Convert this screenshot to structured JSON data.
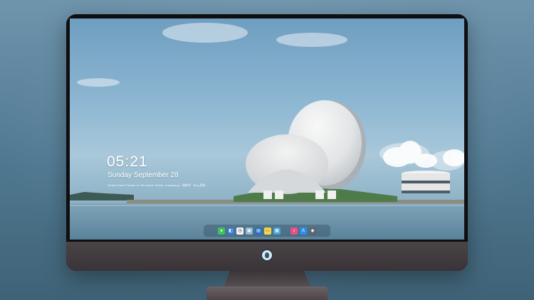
{
  "lockscreen": {
    "time": "05:21",
    "date": "Sunday September 28",
    "caption": "Zhuhai Grand Theatre on Yeli Island, Zhuhai, Guangdong · 摄影师 · Bing 壁纸"
  },
  "dock": {
    "items": [
      {
        "name": "messages-icon",
        "color": "#3fc35b",
        "glyph": "●"
      },
      {
        "name": "finder-icon",
        "color": "#3a7bd5",
        "glyph": "◧"
      },
      {
        "name": "clock-icon",
        "color": "#f2f2f2",
        "glyph": "◷"
      },
      {
        "name": "preview-icon",
        "color": "#8fb8d0",
        "glyph": "▣"
      },
      {
        "name": "clapper-icon",
        "color": "#2d6fc4",
        "glyph": "▤"
      },
      {
        "name": "notes-icon",
        "color": "#f5d547",
        "glyph": "▭"
      },
      {
        "name": "photos-icon",
        "color": "#4aa3df",
        "glyph": "▩"
      },
      {
        "name": "music-icon",
        "color": "#ee4f84",
        "glyph": "♪"
      },
      {
        "name": "appstore-icon",
        "color": "#2b8ef0",
        "glyph": "A"
      },
      {
        "name": "camera-icon",
        "color": "#5b6470",
        "glyph": "◉"
      }
    ]
  },
  "colors": {
    "bezel": "#0f0f12",
    "chin": "#4a4447",
    "sky": "#8db7d2",
    "water": "#5f8aa3"
  }
}
